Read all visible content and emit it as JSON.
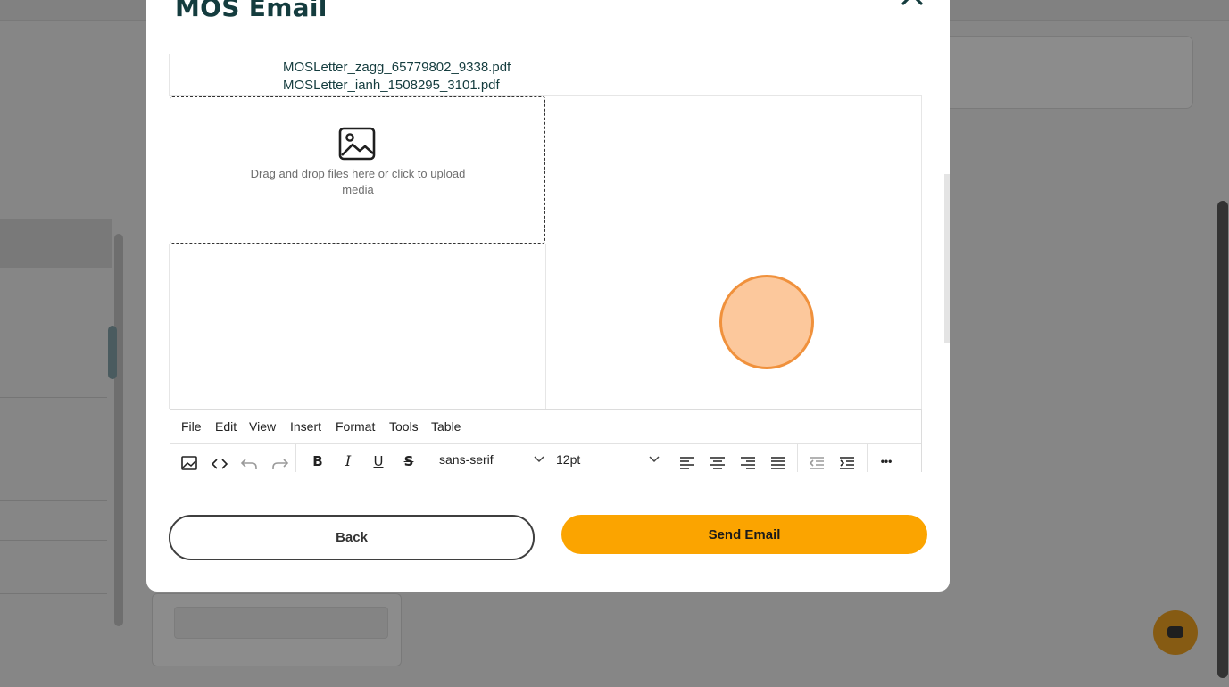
{
  "modal": {
    "title": "MOS Email",
    "close_icon": "close-icon"
  },
  "attachments": [
    "MOSLetter_zagg_65779802_9338.pdf",
    "MOSLetter_ianh_1508295_3101.pdf"
  ],
  "dropzone": {
    "icon": "image-icon",
    "text": "Drag and drop files here or click to upload media"
  },
  "editor": {
    "menu": [
      "File",
      "Edit",
      "View",
      "Insert",
      "Format",
      "Tools",
      "Table"
    ],
    "toolbar": {
      "icons": [
        "image-icon",
        "code-icon",
        "undo-icon",
        "redo-icon",
        "bold-icon",
        "italic-icon",
        "underline-icon",
        "strikethrough-icon",
        "align-left-icon",
        "align-center-icon",
        "align-right-icon",
        "justify-icon",
        "outdent-icon",
        "indent-icon",
        "more-icon"
      ],
      "bold": "B",
      "italic": "I",
      "underline": "U",
      "strike": "S",
      "font_family": "sans-serif",
      "font_size": "12pt",
      "more": "•••"
    }
  },
  "buttons": {
    "back": "Back",
    "send": "Send Email"
  },
  "colors": {
    "title": "#143c3e",
    "primary": "#fba400",
    "cursor_fill": "#fcc89c",
    "cursor_stroke": "#f0913c"
  }
}
